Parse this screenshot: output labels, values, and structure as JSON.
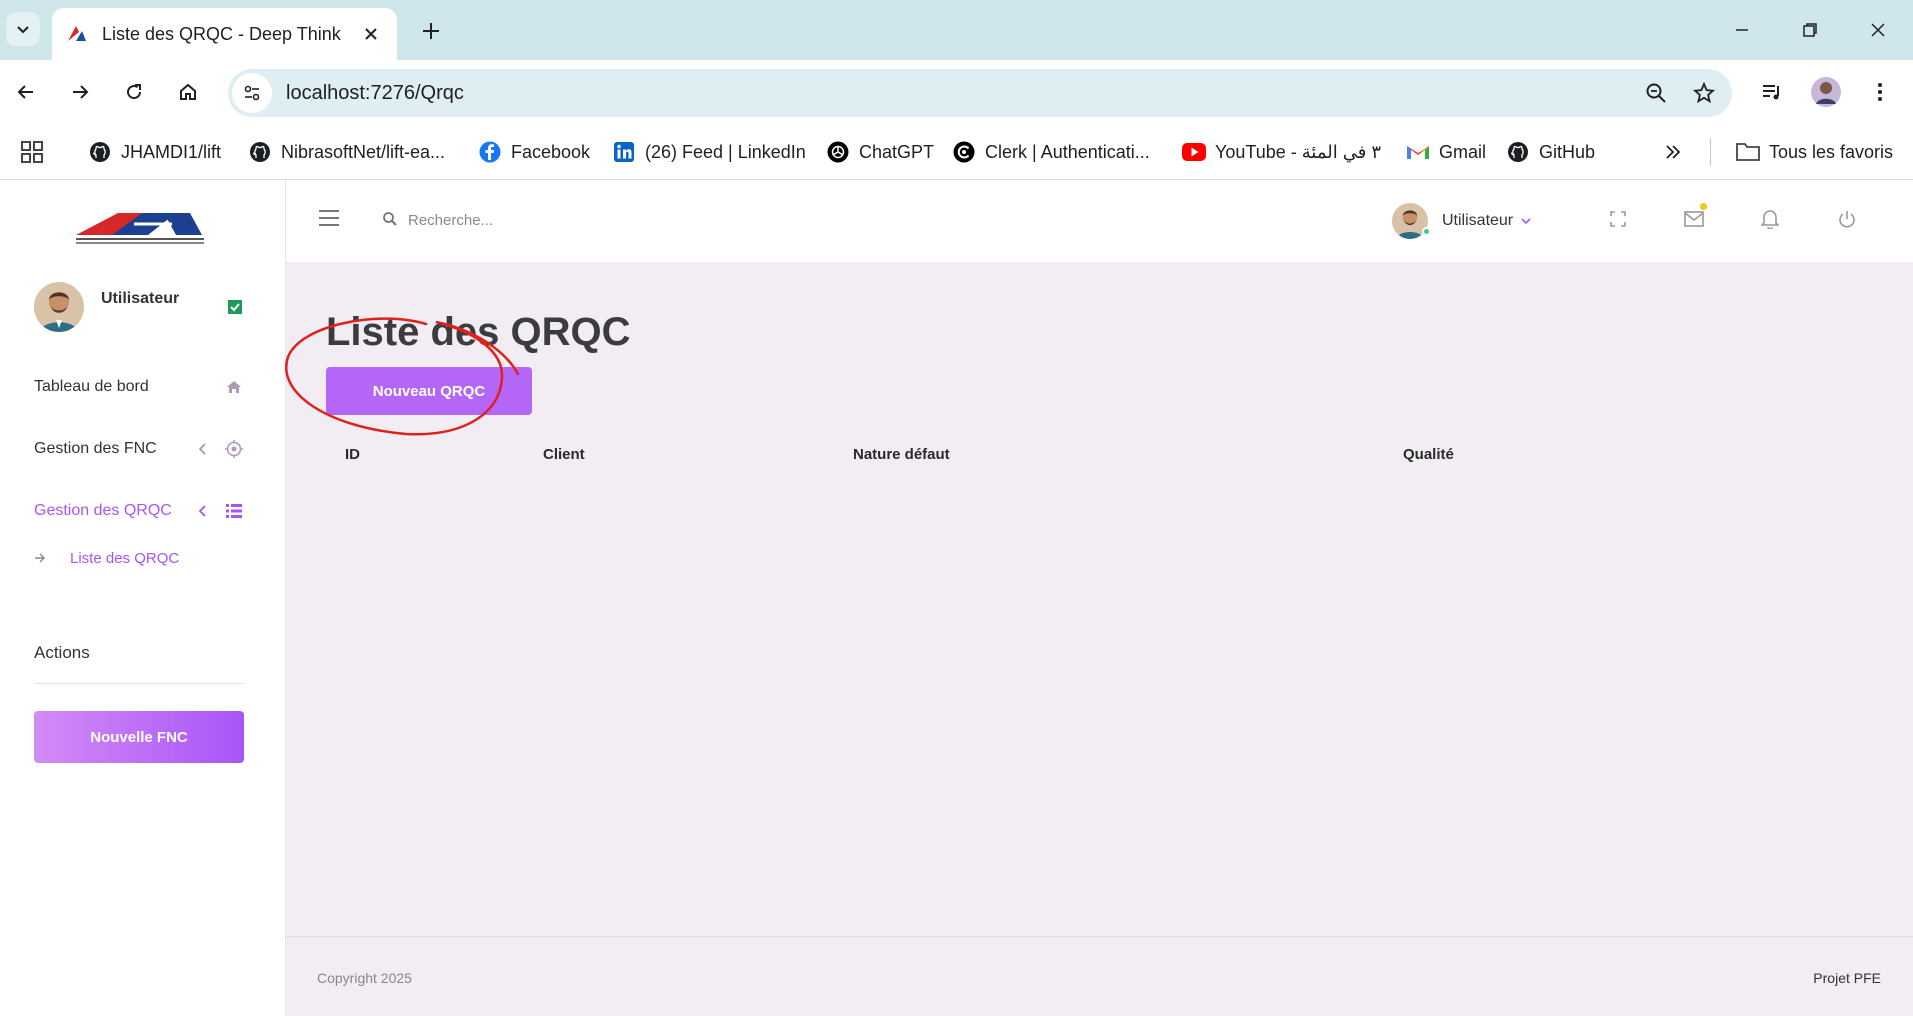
{
  "browser": {
    "tab_title": "Liste des QRQC - Deep Think",
    "url": "localhost:7276/Qrqc",
    "bookmarks": [
      {
        "label": "JHAMDI1/lift",
        "icon": "github-icon"
      },
      {
        "label": "NibrasoftNet/lift-ea...",
        "icon": "github-icon"
      },
      {
        "label": "Facebook",
        "icon": "facebook-icon"
      },
      {
        "label": "(26) Feed | LinkedIn",
        "icon": "linkedin-icon"
      },
      {
        "label": "ChatGPT",
        "icon": "chatgpt-icon"
      },
      {
        "label": "Clerk | Authenticati...",
        "icon": "clerk-icon"
      },
      {
        "label": "YouTube - ٣ في المئة",
        "icon": "youtube-icon"
      },
      {
        "label": "Gmail",
        "icon": "gmail-icon"
      },
      {
        "label": "GitHub",
        "icon": "github-icon"
      }
    ],
    "all_bookmarks": "Tous les favoris"
  },
  "sidebar": {
    "user_name": "Utilisateur",
    "nav": [
      {
        "label": "Tableau de bord",
        "icon": "home-icon"
      },
      {
        "label": "Gestion des FNC",
        "icon": "target-icon"
      },
      {
        "label": "Gestion des QRQC",
        "icon": "list-icon"
      }
    ],
    "sub_item": "Liste des QRQC",
    "actions_title": "Actions",
    "new_fnc_button": "Nouvelle FNC"
  },
  "topbar": {
    "search_placeholder": "Recherche...",
    "user_name": "Utilisateur"
  },
  "main": {
    "page_title": "Liste des QRQC",
    "new_qrqc_button": "Nouveau QRQC",
    "table_headers": [
      "ID",
      "Client",
      "Nature défaut",
      "Qualité"
    ]
  },
  "footer": {
    "copyright": "Copyright 2025",
    "project": "Projet PFE"
  },
  "colors": {
    "accent": "#a855f7",
    "content_bg": "#f1edf2",
    "annotation": "#e0201a"
  }
}
